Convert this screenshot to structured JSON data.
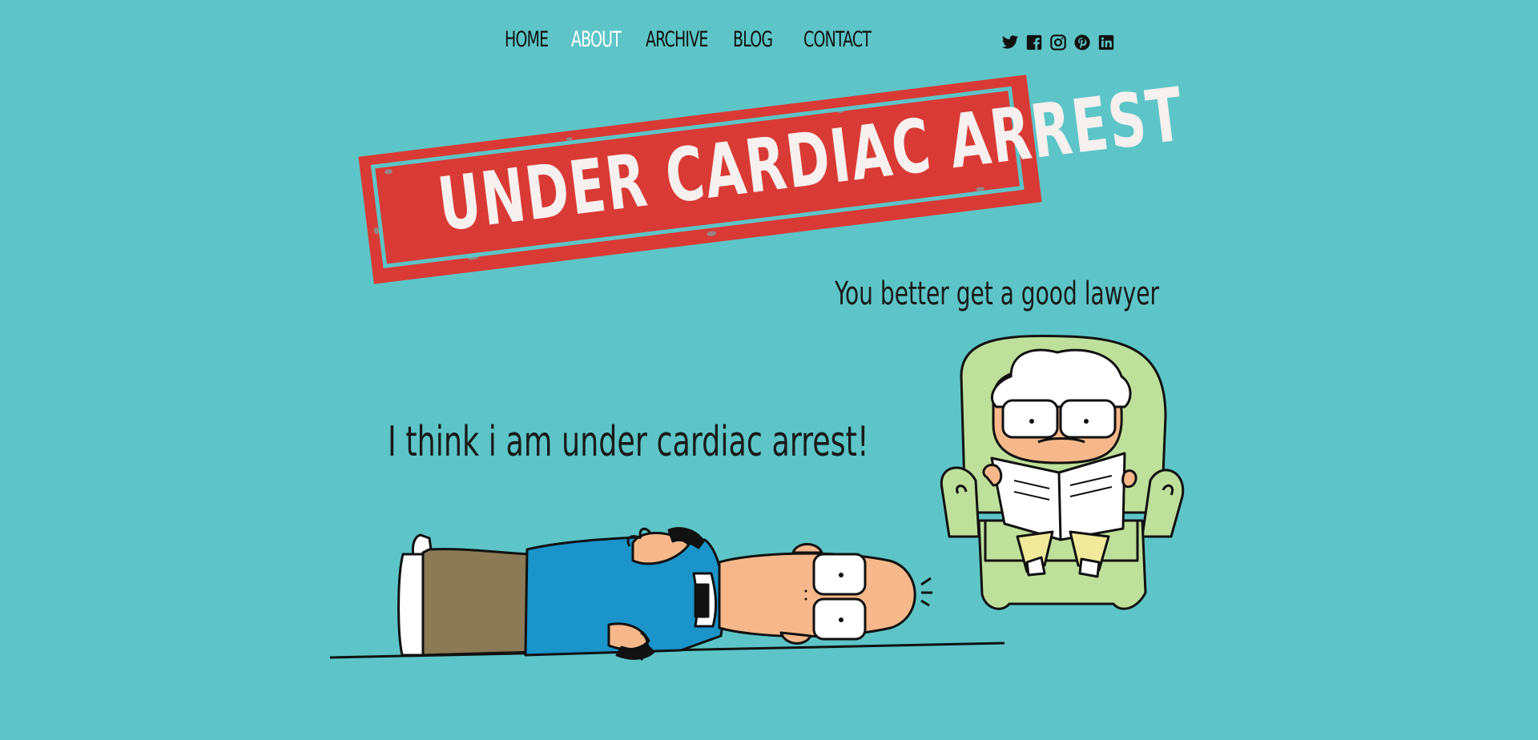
{
  "nav": {
    "items": [
      {
        "label": "HOME",
        "active": false
      },
      {
        "label": "ABOUT",
        "active": true
      },
      {
        "label": "ARCHIVE",
        "active": false
      },
      {
        "label": "BLOG",
        "active": false
      },
      {
        "label": "CONTACT",
        "active": false
      }
    ],
    "active_color": "#ffffff",
    "inactive_color": "#111111"
  },
  "social": {
    "icons": [
      "twitter-icon",
      "facebook-icon",
      "instagram-icon",
      "pinterest-icon",
      "linkedin-icon"
    ]
  },
  "comic": {
    "title": "UNDER CARDIAC ARREST",
    "lawyer_line": "You better get a good lawyer",
    "patient_line": "I think i am under cardiac arrest!"
  },
  "colors": {
    "background": "#5dc5c7",
    "stamp_red": "#d93a35",
    "stamp_text": "#f6f0ee",
    "chair_green": "#bfe09a",
    "skin": "#f6b88a",
    "shirt_blue": "#1a94c9",
    "pants_brown": "#8b7a55"
  }
}
